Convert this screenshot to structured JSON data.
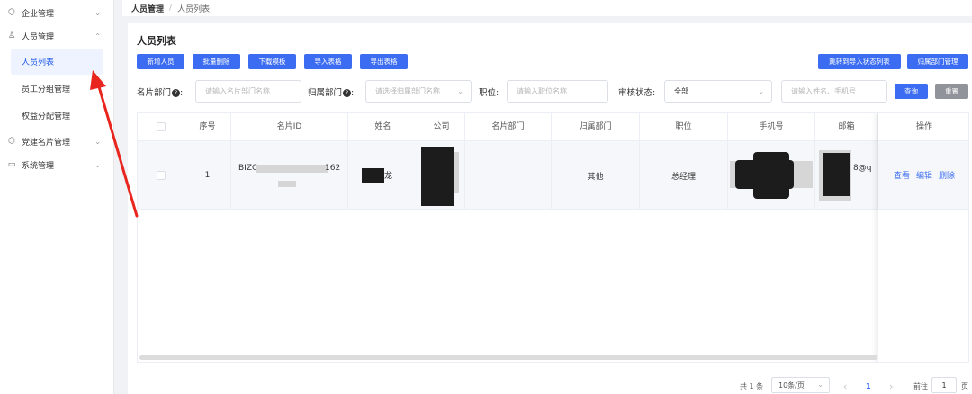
{
  "sidebar": {
    "groups": [
      {
        "label": "企业管理",
        "icon": "hexagon-icon",
        "expanded": false
      },
      {
        "label": "人员管理",
        "icon": "user-icon",
        "expanded": true
      },
      {
        "label": "党建名片管理",
        "icon": "hexagon-icon",
        "expanded": false
      },
      {
        "label": "系统管理",
        "icon": "monitor-icon",
        "expanded": false
      }
    ],
    "items": [
      {
        "label": "人员列表",
        "active": true
      },
      {
        "label": "员工分组管理",
        "active": false
      },
      {
        "label": "权益分配管理",
        "active": false
      }
    ]
  },
  "breadcrumb": {
    "root": "人员管理",
    "sep": "/",
    "current": "人员列表"
  },
  "page_title": "人员列表",
  "toolbar": {
    "add": "新增人员",
    "batch_delete": "批量删除",
    "download_template": "下载模板",
    "import": "导入表格",
    "export": "导出表格",
    "jump_import": "跳转到导入状态列表",
    "dept_manage": "归属部门管理"
  },
  "filters": {
    "card_dept_label": "名片部门",
    "card_dept_placeholder": "请输入名片部门名称",
    "belong_dept_label": "归属部门",
    "belong_dept_placeholder": "请选择归属部门名称",
    "position_label": "职位:",
    "position_placeholder": "请输入职位名称",
    "audit_label": "审核状态:",
    "audit_value": "全部",
    "keyword_placeholder": "请输入姓名、手机号",
    "query": "查询",
    "reset": "重置",
    "help": "?",
    "colon": ":"
  },
  "table": {
    "headers": [
      "序号",
      "名片ID",
      "姓名",
      "公司",
      "名片部门",
      "归属部门",
      "职位",
      "手机号",
      "邮箱",
      "操作"
    ],
    "rows": [
      {
        "index": "1",
        "card_id_prefix": "BIZC",
        "card_id_suffix": "162",
        "name_suffix": "龙",
        "company": "",
        "card_dept": "",
        "belong_dept": "其他",
        "position": "总经理",
        "phone": "",
        "email_fragment": "8@q",
        "actions": [
          "查看",
          "编辑",
          "删除"
        ]
      }
    ]
  },
  "pagination": {
    "total": "共 1 条",
    "page_size": "10条/页",
    "prev": "‹",
    "current": "1",
    "next": "›",
    "goto_label": "前往",
    "goto_value": "1",
    "page_unit": "页"
  },
  "colors": {
    "primary": "#3b6cf1",
    "annotation_arrow": "#e8261f"
  }
}
